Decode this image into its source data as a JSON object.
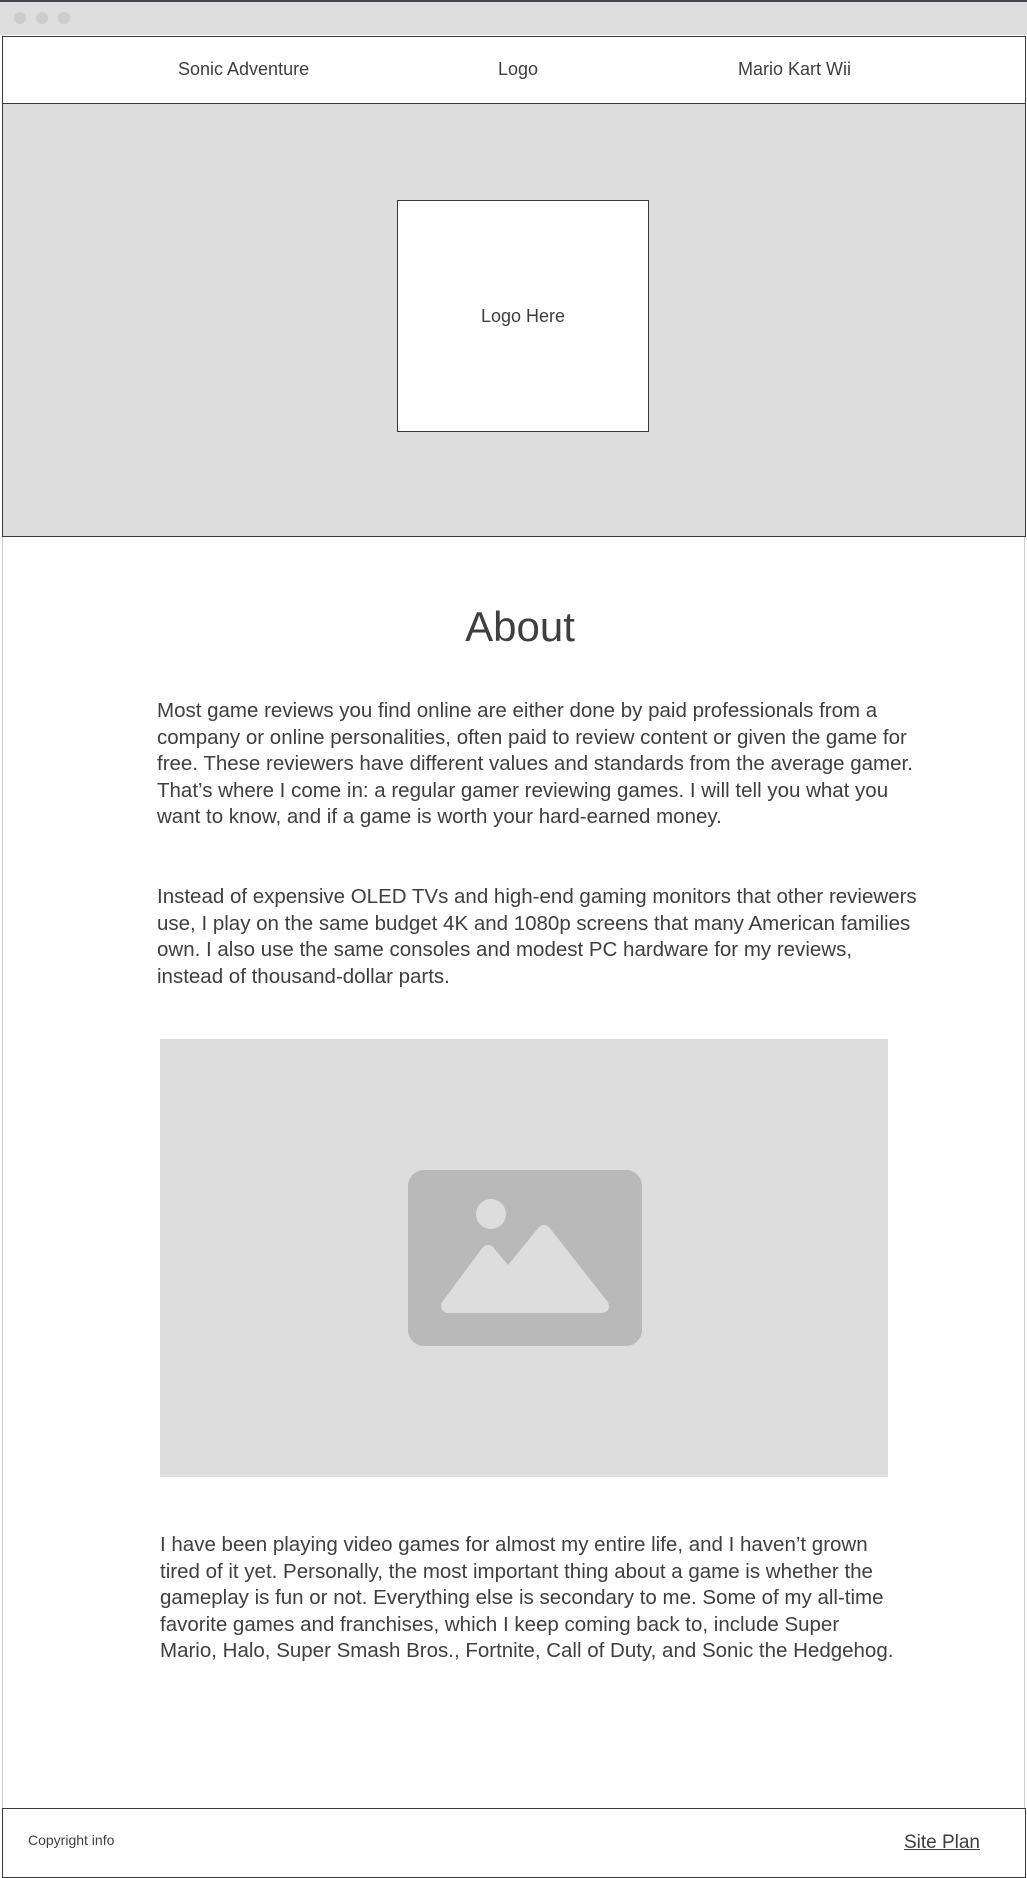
{
  "nav": {
    "left_link": "Sonic Adventure",
    "center_logo": "Logo",
    "right_link": "Mario Kart Wii"
  },
  "hero": {
    "logo_placeholder": "Logo Here"
  },
  "about": {
    "title": "About",
    "paragraph_1": "Most game reviews you find online are either done by paid professionals from a company or online personalities, often paid to review content or given the game for free. These reviewers have different values and standards from the average gamer. That’s where I come in: a regular gamer reviewing games. I will tell you what you want to know, and if a game is worth your hard-earned money.",
    "paragraph_2": "Instead of expensive OLED TVs and high-end gaming monitors that other reviewers use, I play on the same budget 4K and 1080p screens that many American families own. I also use the same consoles and modest PC hardware for my reviews, instead of thousand-dollar parts.",
    "image_icon": "image-placeholder-icon",
    "paragraph_3": "I have been playing video games for almost my entire life, and I haven’t grown tired of it yet. Personally, the most important thing about a game is whether the gameplay is fun or not. Everything else is secondary to me. Some of my all-time favorite games and franchises, which I keep coming back to, include Super Mario, Halo, Super Smash Bros., Fortnite, Call of Duty, and Sonic the Hedgehog."
  },
  "footer": {
    "copyright": "Copyright info",
    "site_plan": "Site Plan"
  },
  "colors": {
    "text": "#3f3f3f",
    "placeholder_bg": "#dddddd",
    "placeholder_icon": "#b9b9b9",
    "border": "#3a3a3a"
  }
}
